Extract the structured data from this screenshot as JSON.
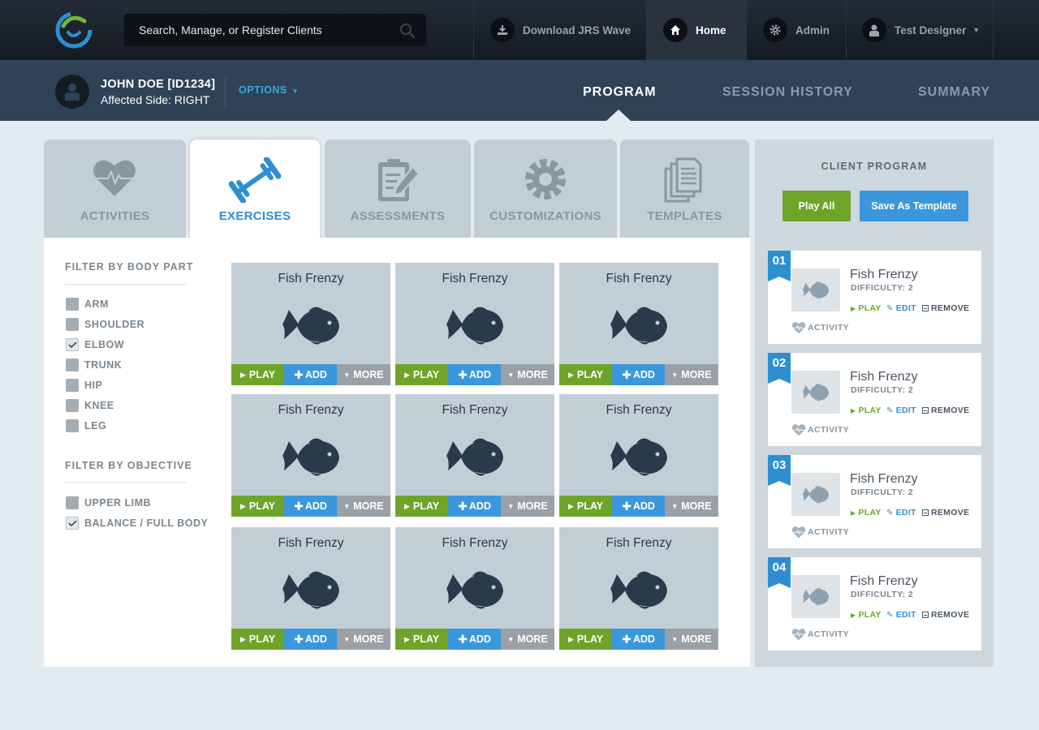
{
  "topnav": {
    "search_placeholder": "Search, Manage, or Register Clients",
    "items": [
      {
        "label": "Download JRS Wave",
        "icon": "download-icon"
      },
      {
        "label": "Home",
        "icon": "home-icon",
        "active": true
      },
      {
        "label": "Admin",
        "icon": "gear-icon"
      },
      {
        "label": "Test Designer",
        "icon": "user-icon"
      }
    ]
  },
  "client": {
    "name": "JOHN DOE [ID1234]",
    "affected_side": "Affected Side: RIGHT",
    "options_label": "OPTIONS"
  },
  "program_tabs": [
    "PROGRAM",
    "SESSION HISTORY",
    "SUMMARY"
  ],
  "category_tabs": [
    "ACTIVITIES",
    "EXERCISES",
    "ASSESSMENTS",
    "CUSTOMIZATIONS",
    "TEMPLATES"
  ],
  "filters": {
    "body_part_title": "FILTER BY BODY PART",
    "body_parts": [
      {
        "label": "ARM",
        "checked": false
      },
      {
        "label": "SHOULDER",
        "checked": false
      },
      {
        "label": "ELBOW",
        "checked": true
      },
      {
        "label": "TRUNK",
        "checked": false
      },
      {
        "label": "HIP",
        "checked": false
      },
      {
        "label": "KNEE",
        "checked": false
      },
      {
        "label": "LEG",
        "checked": false
      }
    ],
    "objective_title": "FILTER BY OBJECTIVE",
    "objectives": [
      {
        "label": "UPPER LIMB",
        "checked": false
      },
      {
        "label": "BALANCE / FULL BODY",
        "checked": true
      }
    ]
  },
  "exercise_cards": [
    {
      "title": "Fish Frenzy"
    },
    {
      "title": "Fish Frenzy"
    },
    {
      "title": "Fish Frenzy"
    },
    {
      "title": "Fish Frenzy"
    },
    {
      "title": "Fish Frenzy"
    },
    {
      "title": "Fish Frenzy"
    },
    {
      "title": "Fish Frenzy"
    },
    {
      "title": "Fish Frenzy"
    },
    {
      "title": "Fish Frenzy"
    }
  ],
  "card_actions": {
    "play": "PLAY",
    "add": "ADD",
    "more": "MORE"
  },
  "client_program": {
    "title": "CLIENT PROGRAM",
    "play_all": "Play All",
    "save_template": "Save As Template",
    "items": [
      {
        "num": "01",
        "title": "Fish Frenzy",
        "difficulty": "DIFFICULTY: 2"
      },
      {
        "num": "02",
        "title": "Fish Frenzy",
        "difficulty": "DIFFICULTY: 2"
      },
      {
        "num": "03",
        "title": "Fish Frenzy",
        "difficulty": "DIFFICULTY: 2"
      },
      {
        "num": "04",
        "title": "Fish Frenzy",
        "difficulty": "DIFFICULTY: 2"
      }
    ],
    "actions": {
      "play": "PLAY",
      "edit": "EDIT",
      "remove": "REMOVE",
      "activity": "ACTIVITY"
    }
  }
}
